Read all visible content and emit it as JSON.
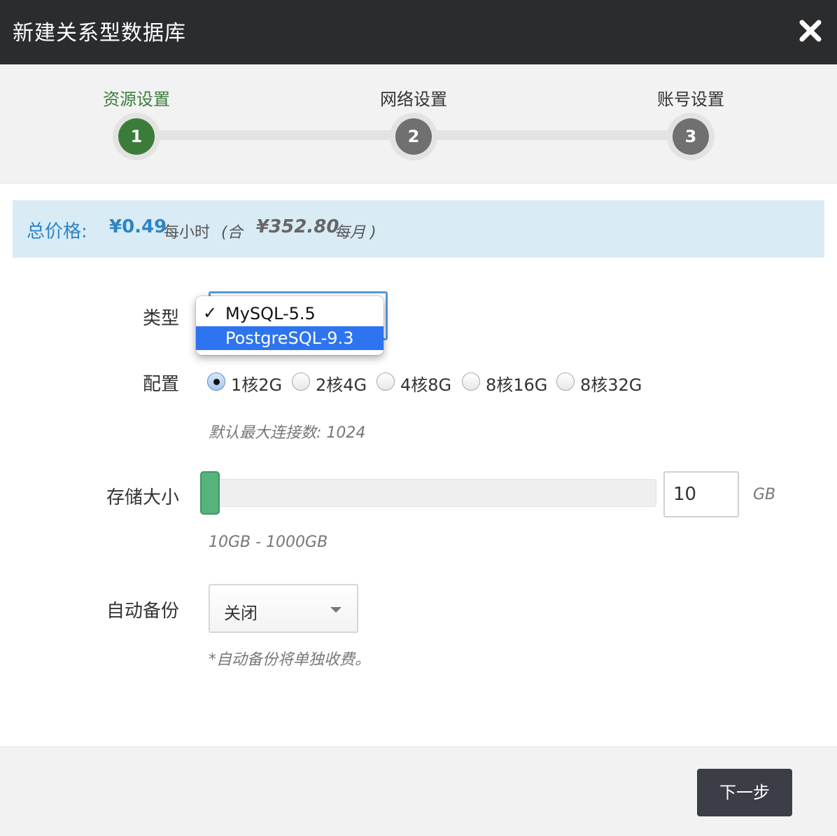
{
  "header": {
    "title": "新建关系型数据库",
    "close_icon": "close-icon"
  },
  "steps": [
    {
      "label": "资源设置",
      "number": "1",
      "active": true
    },
    {
      "label": "网络设置",
      "number": "2",
      "active": false
    },
    {
      "label": "账号设置",
      "number": "3",
      "active": false
    }
  ],
  "price": {
    "label": "总价格:",
    "hourly": "¥0.49",
    "hourly_unit": "每小时",
    "paren_open": "(合",
    "monthly": "¥352.80",
    "monthly_unit": "每月 )"
  },
  "type": {
    "label": "类型",
    "options": [
      {
        "label": "MySQL-5.5",
        "checked": true
      },
      {
        "label": "PostgreSQL-9.3",
        "highlighted": true
      }
    ],
    "check_mark": "✓"
  },
  "config": {
    "label": "配置",
    "options": [
      "1核2G",
      "2核4G",
      "4核8G",
      "8核16G",
      "8核32G"
    ],
    "selected": "1核2G",
    "hint": "默认最大连接数: 1024"
  },
  "storage": {
    "label": "存储大小",
    "value": "10",
    "unit": "GB",
    "range_hint": "10GB - 1000GB",
    "min": 10,
    "max": 1000,
    "fraction": 0.0
  },
  "backup": {
    "label": "自动备份",
    "value": "关闭",
    "hint": "*自动备份将单独收费。"
  },
  "footer": {
    "next_label": "下一步"
  },
  "colors": {
    "accent_green": "#3a7d3a",
    "price_blue": "#2e84c6",
    "slider_green": "#55b37b",
    "header_bg": "#2b2c2e"
  }
}
